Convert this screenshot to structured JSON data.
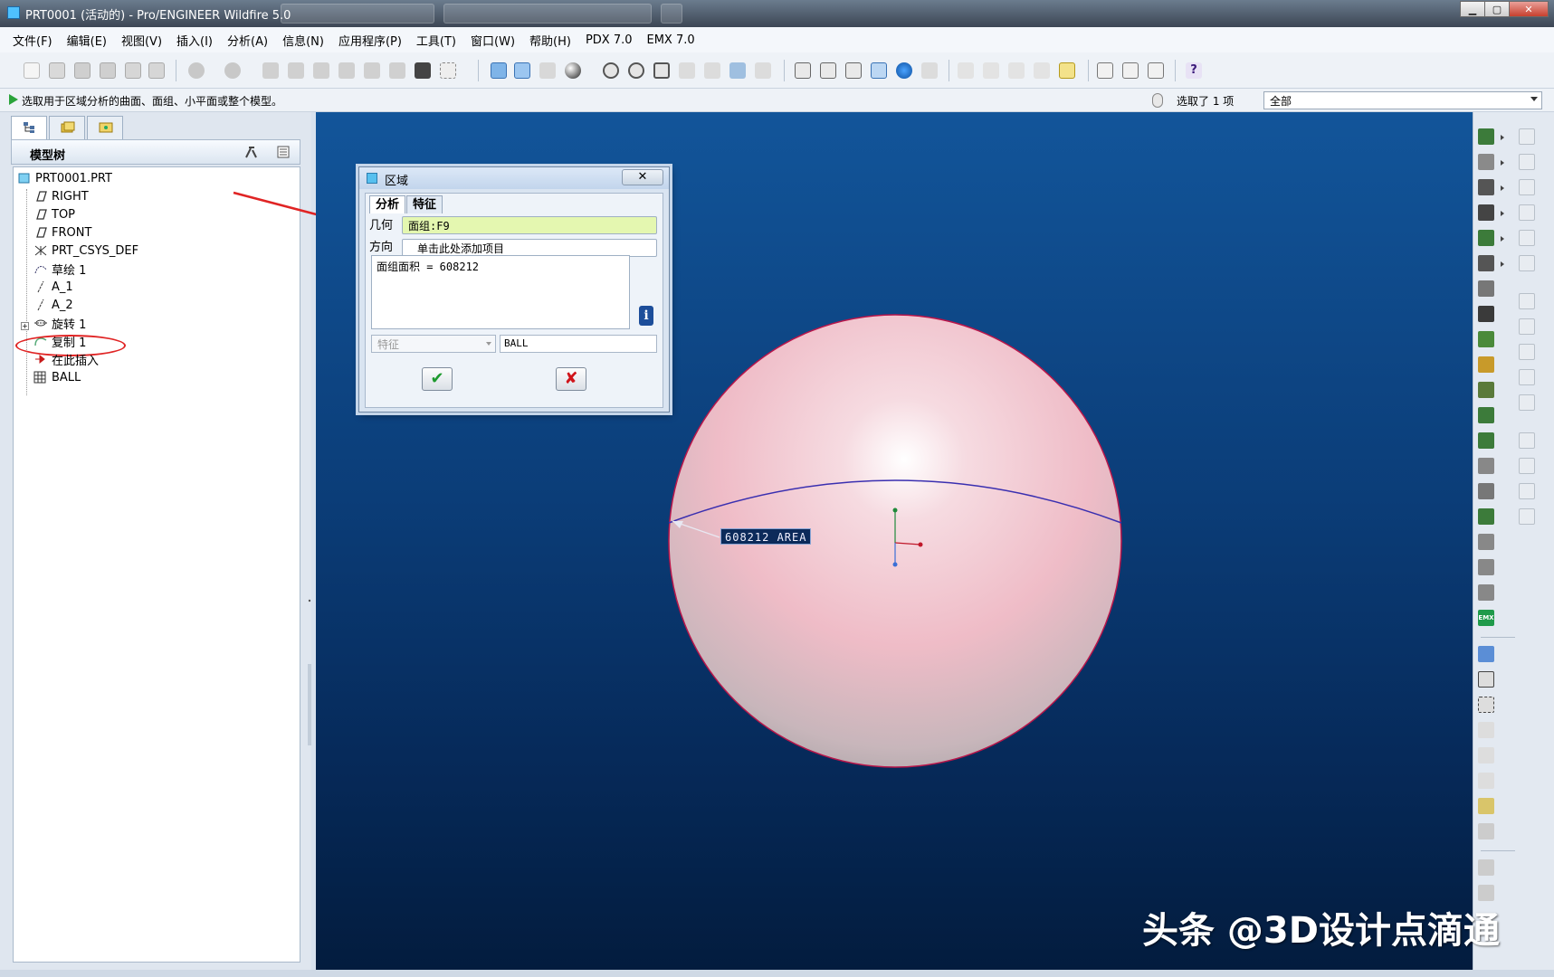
{
  "window": {
    "title": "PRT0001 (活动的) - Pro/ENGINEER Wildfire 5.0"
  },
  "menu": [
    "文件(F)",
    "编辑(E)",
    "视图(V)",
    "插入(I)",
    "分析(A)",
    "信息(N)",
    "应用程序(P)",
    "工具(T)",
    "窗口(W)",
    "帮助(H)",
    "PDX 7.0",
    "EMX 7.0"
  ],
  "prompt": {
    "message": "选取用于区域分析的曲面、面组、小平面或整个模型。",
    "selected_count": "选取了 1 项",
    "filter": "全部"
  },
  "model_tree": {
    "header": "模型树",
    "items": [
      "PRT0001.PRT",
      "RIGHT",
      "TOP",
      "FRONT",
      "PRT_CSYS_DEF",
      "草绘 1",
      "A_1",
      "A_2",
      "旋转 1",
      "复制 1",
      "在此插入",
      "BALL"
    ]
  },
  "dialog": {
    "title": "区域",
    "close": "✕",
    "tabs": [
      "分析",
      "特征"
    ],
    "geometry_label": "几何",
    "geometry_value": "面组:F9",
    "direction_label": "方向",
    "direction_value": "单击此处添加项目",
    "result_text": "面组面积 = 608212",
    "info_glyph": "i",
    "type_select": "特征",
    "feature_name": "BALL",
    "ok": "✔",
    "cancel": "✘"
  },
  "viewport": {
    "annotation": "608212 AREA"
  },
  "watermark": "头条 @3D设计点滴通",
  "colors": {
    "viewport_top": "#12559a",
    "viewport_bottom": "#031c3e",
    "sphere": "#f2c4ce",
    "highlight_edge": "#c0184a",
    "geometry_field": "#e4f7b0",
    "annotation_red": "#e02424"
  },
  "icons": {
    "ok": "checkmark-icon",
    "cancel": "x-icon",
    "info": "info-icon"
  }
}
